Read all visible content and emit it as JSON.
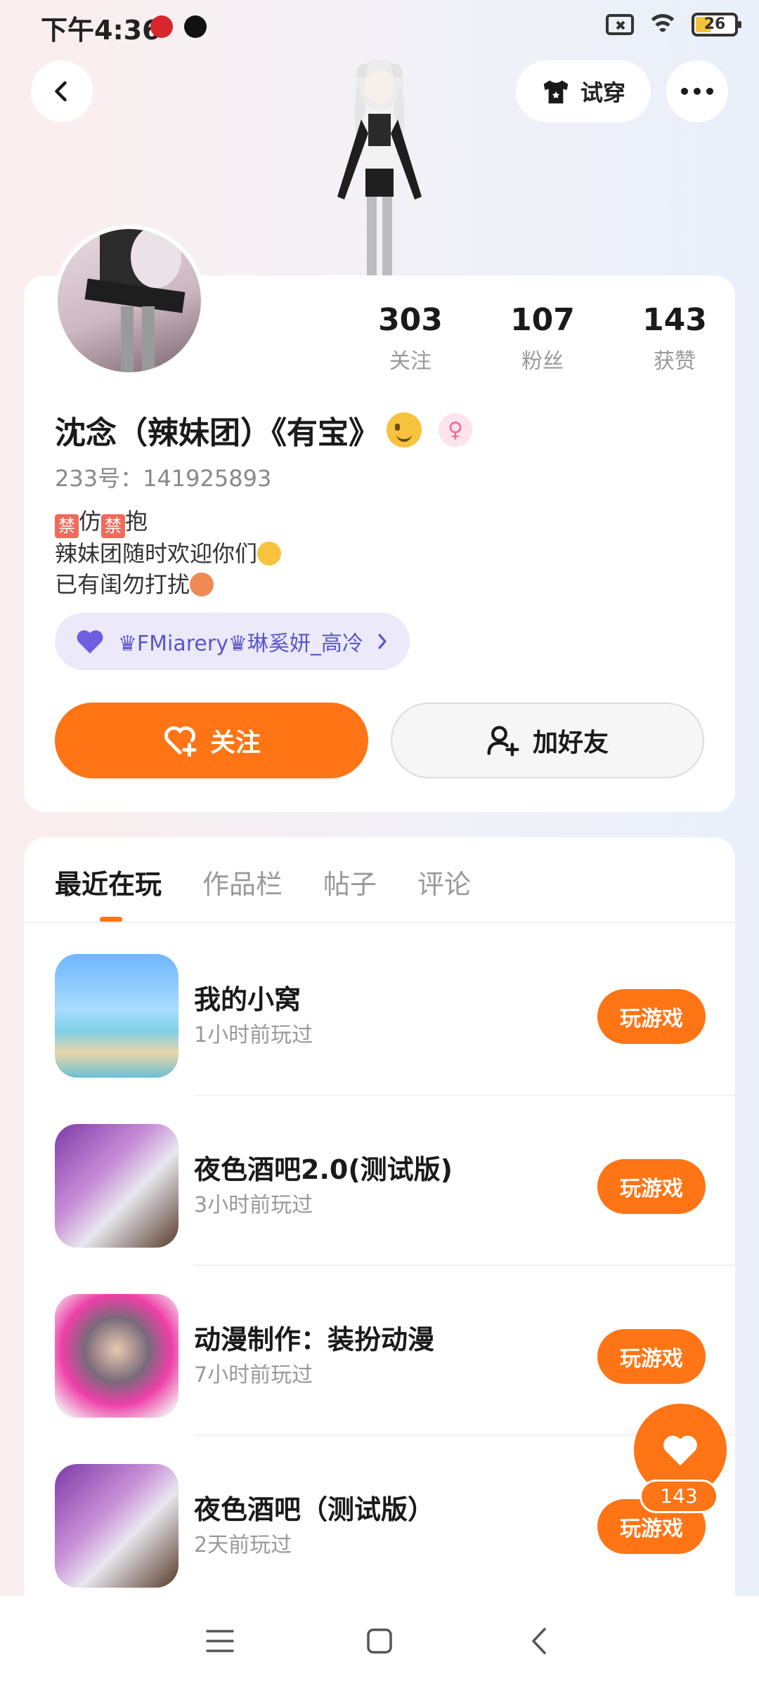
{
  "status_bar": {
    "time": "下午4:36",
    "battery": "26"
  },
  "header": {
    "try_on_label": "试穿"
  },
  "profile": {
    "stats": [
      {
        "value": "303",
        "label": "关注"
      },
      {
        "value": "107",
        "label": "粉丝"
      },
      {
        "value": "143",
        "label": "获赞"
      }
    ],
    "name": "沈念（辣妹团）《有宝》",
    "uid": "233号：141925893",
    "bio": {
      "line1_ban": "禁",
      "line1_a": "仿",
      "line1_b": "抱",
      "line2": "辣妹团随时欢迎你们",
      "line3": "已有闺勿打扰"
    },
    "family_label": "♛FMiarery♛琳奚妍_高冷",
    "follow_label": "关注",
    "add_friend_label": "加好友"
  },
  "tabs": [
    "最近在玩",
    "作品栏",
    "帖子",
    "评论"
  ],
  "games": [
    {
      "title": "我的小窝",
      "time": "1小时前玩过",
      "button": "玩游戏"
    },
    {
      "title": "夜色酒吧2.0(测试版)",
      "time": "3小时前玩过",
      "button": "玩游戏"
    },
    {
      "title": "动漫制作：装扮动漫",
      "time": "7小时前玩过",
      "button": "玩游戏"
    },
    {
      "title": "夜色酒吧（测试版）",
      "time": "2天前玩过",
      "button": "玩游戏"
    }
  ],
  "like_fab": {
    "count": "143"
  },
  "colors": {
    "accent": "#ff7414",
    "family_bg": "#ece9fb",
    "family_text": "#5a56c9"
  },
  "icons": [
    "back-icon",
    "tshirt-icon",
    "more-icon",
    "heart-plus-icon",
    "user-plus-icon",
    "heart-icon",
    "menu-icon",
    "home-icon",
    "nav-back-icon"
  ]
}
